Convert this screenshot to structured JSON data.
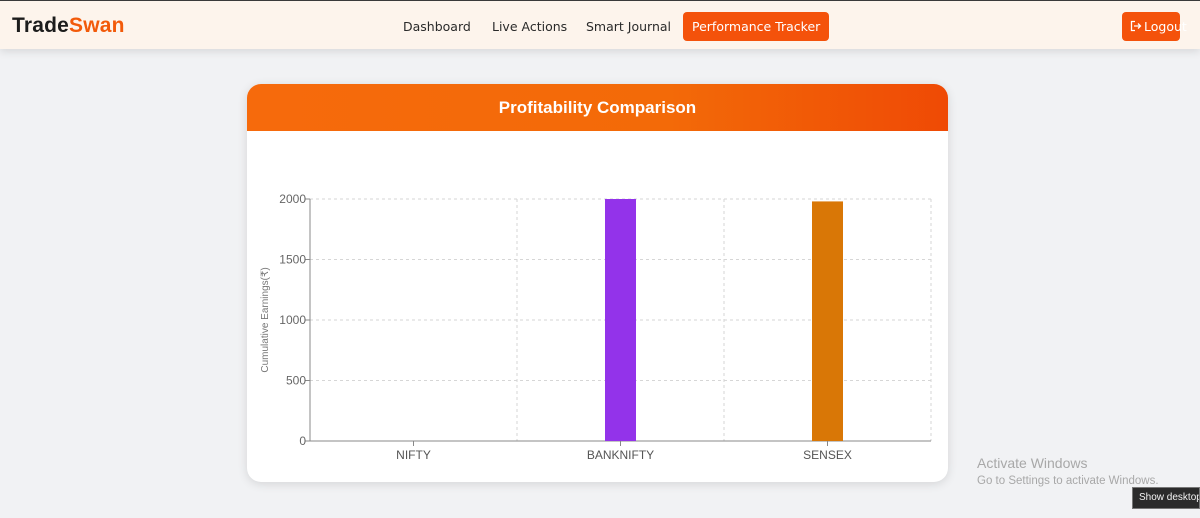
{
  "app": {
    "logo_part1": "Trade",
    "logo_part2": "Swan",
    "brand_color": "#f4520b"
  },
  "nav": {
    "items": [
      {
        "label": "Dashboard"
      },
      {
        "label": "Live Actions"
      },
      {
        "label": "Smart Journal"
      },
      {
        "label": "Performance Tracker",
        "active": true
      }
    ],
    "logout_label": "Logout",
    "logout_icon": "logout-icon"
  },
  "card": {
    "title": "Profitability Comparison"
  },
  "chart_data": {
    "type": "bar",
    "title": "Profitability Comparison",
    "categories": [
      "NIFTY",
      "BANKNIFTY",
      "SENSEX"
    ],
    "values": [
      0,
      2000,
      1980
    ],
    "colors": [
      "#cccccc",
      "#9333ea",
      "#d97706"
    ],
    "ylabel": "Cumulative Earnings(₹)",
    "xlabel": "",
    "yticks": [
      0,
      500,
      1000,
      1500,
      2000
    ],
    "ylim": [
      0,
      2000
    ],
    "grid": true
  },
  "os_overlay": {
    "watermark_title": "Activate Windows",
    "watermark_subtitle": "Go to Settings to activate Windows.",
    "tooltip": "Show desktop"
  }
}
